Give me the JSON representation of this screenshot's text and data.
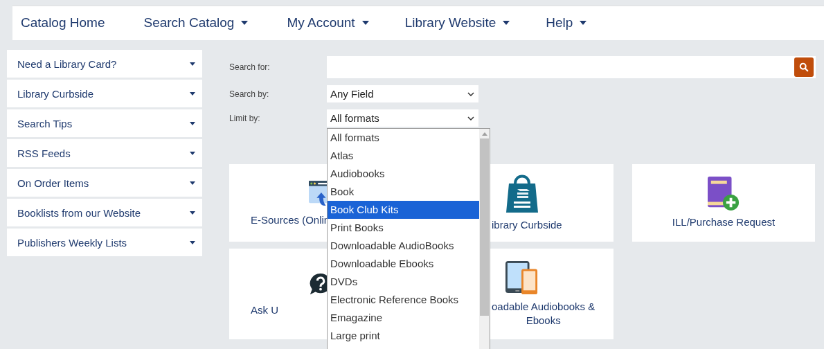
{
  "nav": [
    {
      "label": "Catalog Home",
      "has_menu": false
    },
    {
      "label": "Search Catalog",
      "has_menu": true
    },
    {
      "label": "My Account",
      "has_menu": true
    },
    {
      "label": "Library Website",
      "has_menu": true
    },
    {
      "label": "Help",
      "has_menu": true
    }
  ],
  "sidebar": {
    "items": [
      {
        "label": "Need a Library Card?"
      },
      {
        "label": "Library Curbside"
      },
      {
        "label": "Search Tips"
      },
      {
        "label": "RSS Feeds"
      },
      {
        "label": "On Order Items"
      },
      {
        "label": "Booklists from our Website"
      },
      {
        "label": "Publishers Weekly Lists"
      }
    ]
  },
  "search": {
    "search_for_label": "Search for:",
    "search_by_label": "Search by:",
    "search_by_value": "Any Field",
    "limit_by_label": "Limit by:",
    "limit_by_value": "All formats"
  },
  "format_options": [
    {
      "label": "All formats",
      "selected": false
    },
    {
      "label": "Atlas",
      "selected": false
    },
    {
      "label": "Audiobooks",
      "selected": false
    },
    {
      "label": "Book",
      "selected": false
    },
    {
      "label": "Book Club Kits",
      "selected": true
    },
    {
      "label": "Print Books",
      "selected": false
    },
    {
      "label": "Downloadable AudioBooks",
      "selected": false
    },
    {
      "label": "Downloadable Ebooks",
      "selected": false
    },
    {
      "label": "DVDs",
      "selected": false
    },
    {
      "label": "Electronic Reference Books",
      "selected": false
    },
    {
      "label": "Emagazine",
      "selected": false
    },
    {
      "label": "Large print",
      "selected": false
    }
  ],
  "tiles": [
    {
      "kind": "browser",
      "lines": [
        "E-Sources (Onlin"
      ]
    },
    {
      "kind": "bag",
      "lines": [
        "ibrary Curbside"
      ]
    },
    {
      "kind": "book",
      "lines": [
        "ILL/Purchase Request"
      ]
    },
    {
      "kind": "question",
      "lines": [
        "Ask U"
      ]
    },
    {
      "kind": "devices",
      "lines": [
        "oadable Audiobooks &",
        "Ebooks"
      ]
    }
  ]
}
